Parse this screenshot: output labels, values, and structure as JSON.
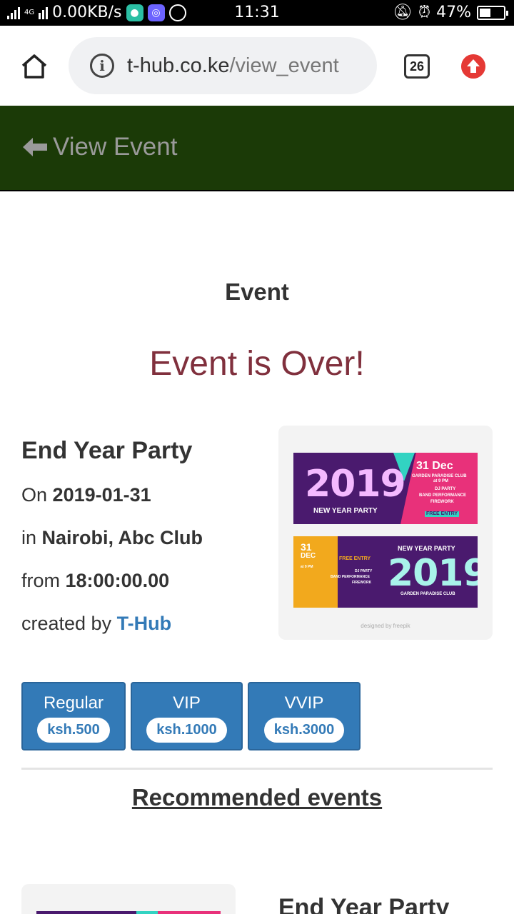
{
  "status_bar": {
    "network": "4G",
    "speed": "0.00KB/s",
    "time": "11:31",
    "battery_percent": "47%",
    "battery_level": 0.47
  },
  "browser": {
    "url_host": "t-hub.co.ke",
    "url_path": "/view_event",
    "tab_count": "26",
    "icons": [
      "home-icon",
      "info-icon",
      "tabs-icon",
      "update-icon"
    ]
  },
  "app_bar": {
    "title": "View Event",
    "background": "#1b3a07"
  },
  "page": {
    "heading": "Event",
    "status_message": "Event is Over!",
    "status_color": "#80303d"
  },
  "event": {
    "title": "End Year Party",
    "date_prefix": "On",
    "date": "2019-01-31",
    "location_prefix": "in",
    "location": "Nairobi, Abc Club",
    "time_prefix": "from",
    "time": "18:00:00.00",
    "creator_prefix": "created by",
    "creator": "T-Hub",
    "poster": {
      "banner1": {
        "year": "2019",
        "subtitle": "NEW YEAR PARTY",
        "date": "31 Dec",
        "venue": "GARDEN PARADISE CLUB",
        "time": "at 9 PM",
        "lines": [
          "DJ PARTY",
          "BAND PERFORMANCE",
          "FIREWORK"
        ],
        "entry": "FREE ENTRY"
      },
      "banner2": {
        "day": "31",
        "month": "DEC",
        "time": "at 9 PM",
        "entry": "FREE ENTRY",
        "lines": [
          "DJ PARTY",
          "BAND PERFORMANCE",
          "FIREWORK"
        ],
        "title": "NEW YEAR PARTY",
        "year": "2019",
        "venue": "GARDEN PARADISE CLUB"
      },
      "credit": "designed by freepik"
    }
  },
  "tickets": [
    {
      "name": "Regular",
      "price": "ksh.500"
    },
    {
      "name": "VIP",
      "price": "ksh.1000"
    },
    {
      "name": "VVIP",
      "price": "ksh.3000"
    }
  ],
  "ticket_color": "#337ab7",
  "recommended": {
    "heading": "Recommended events",
    "items": [
      {
        "title": "End Year Party"
      }
    ]
  }
}
